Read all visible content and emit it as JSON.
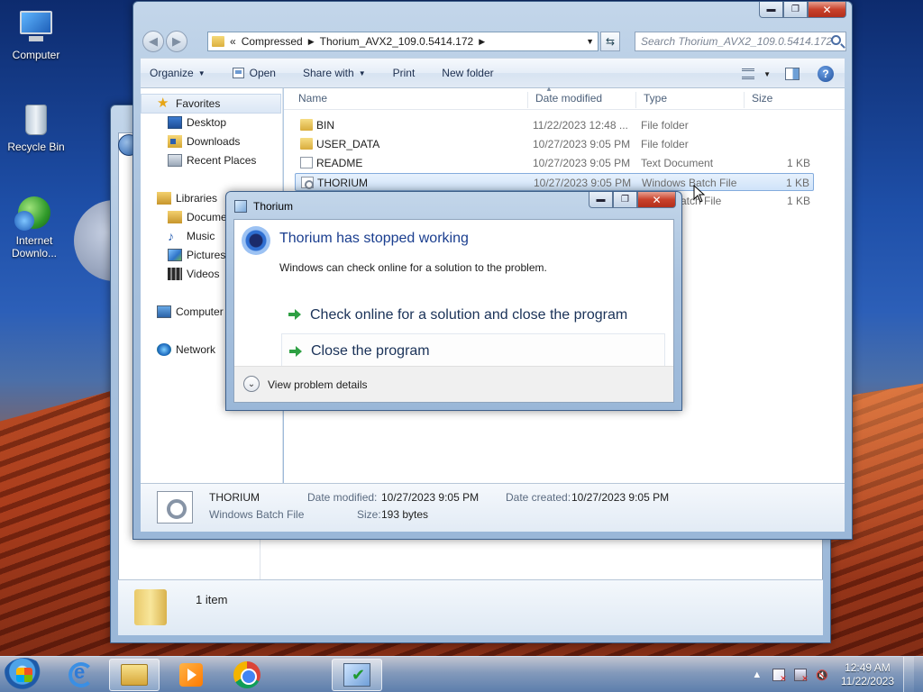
{
  "desktop": {
    "icons": [
      {
        "label": "Computer"
      },
      {
        "label": "Recycle Bin"
      },
      {
        "label": "Internet Downlo..."
      }
    ]
  },
  "back_window": {
    "status_count": "1 item"
  },
  "explorer": {
    "breadcrumb": {
      "prefix": "«",
      "items": [
        "Compressed",
        "Thorium_AVX2_109.0.5414.172"
      ]
    },
    "search_placeholder": "Search Thorium_AVX2_109.0.5414.172",
    "toolbar": {
      "organize": "Organize",
      "open": "Open",
      "share_with": "Share with",
      "print": "Print",
      "new_folder": "New folder"
    },
    "nav": {
      "favorites": "Favorites",
      "desktop": "Desktop",
      "downloads": "Downloads",
      "recent_places": "Recent Places",
      "libraries": "Libraries",
      "documents": "Docume...",
      "music": "Music",
      "pictures": "Pictures",
      "videos": "Videos",
      "computer": "Computer",
      "network": "Network"
    },
    "columns": {
      "name": "Name",
      "date_modified": "Date modified",
      "type": "Type",
      "size": "Size"
    },
    "files": [
      {
        "name": "BIN",
        "date": "11/22/2023 12:48 ...",
        "type": "File folder",
        "size": "",
        "icon": "folder-icon"
      },
      {
        "name": "USER_DATA",
        "date": "10/27/2023 9:05 PM",
        "type": "File folder",
        "size": "",
        "icon": "folder-icon"
      },
      {
        "name": "README",
        "date": "10/27/2023 9:05 PM",
        "type": "Text Document",
        "size": "1 KB",
        "icon": "text-file-icon"
      },
      {
        "name": "THORIUM",
        "date": "10/27/2023 9:05 PM",
        "type": "Windows Batch File",
        "size": "1 KB",
        "icon": "batch-file-icon",
        "selected": true
      },
      {
        "name": "",
        "date": "",
        "type": "Batch File",
        "size": "1 KB",
        "icon": "batch-file-icon"
      }
    ],
    "details": {
      "name": "THORIUM",
      "type": "Windows Batch File",
      "date_modified_label": "Date modified:",
      "date_modified": "10/27/2023 9:05 PM",
      "date_created_label": "Date created:",
      "date_created": "10/27/2023 9:05 PM",
      "size_label": "Size:",
      "size": "193 bytes"
    }
  },
  "dialog": {
    "title": "Thorium",
    "heading": "Thorium has stopped working",
    "subtext": "Windows can check online for a solution to the problem.",
    "option_check": "Check online for a solution and close the program",
    "option_close": "Close the program",
    "details_toggle": "View problem details"
  },
  "taskbar": {
    "time": "12:49 AM",
    "date": "11/22/2023"
  }
}
